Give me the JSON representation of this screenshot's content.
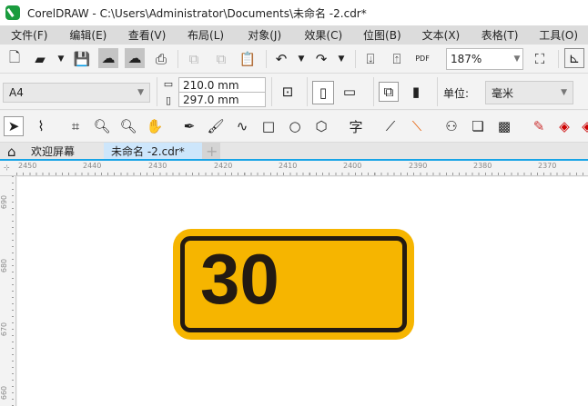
{
  "window": {
    "title": "CorelDRAW - C:\\Users\\Administrator\\Documents\\未命名 -2.cdr*"
  },
  "menu": [
    "文件(F)",
    "编辑(E)",
    "查看(V)",
    "布局(L)",
    "对象(J)",
    "效果(C)",
    "位图(B)",
    "文本(X)",
    "表格(T)",
    "工具(O)"
  ],
  "toolbar": {
    "zoom": "187%",
    "pdf_label": "PDF"
  },
  "property_bar": {
    "page_size": "A4",
    "width": "210.0 mm",
    "height": "297.0 mm",
    "units_label": "单位:",
    "units": "毫米"
  },
  "tabs": [
    {
      "label": "欢迎屏幕"
    },
    {
      "label": "未命名 -2.cdr*"
    }
  ],
  "rulers": {
    "horizontal": [
      "2450",
      "2440",
      "2430",
      "2420",
      "2410",
      "2400",
      "2390",
      "2380",
      "2370"
    ],
    "vertical": [
      "690",
      "680",
      "670",
      "660"
    ]
  },
  "canvas": {
    "sign_text": "30",
    "sign_color": "#f6b500",
    "sign_border": "#231a12"
  }
}
